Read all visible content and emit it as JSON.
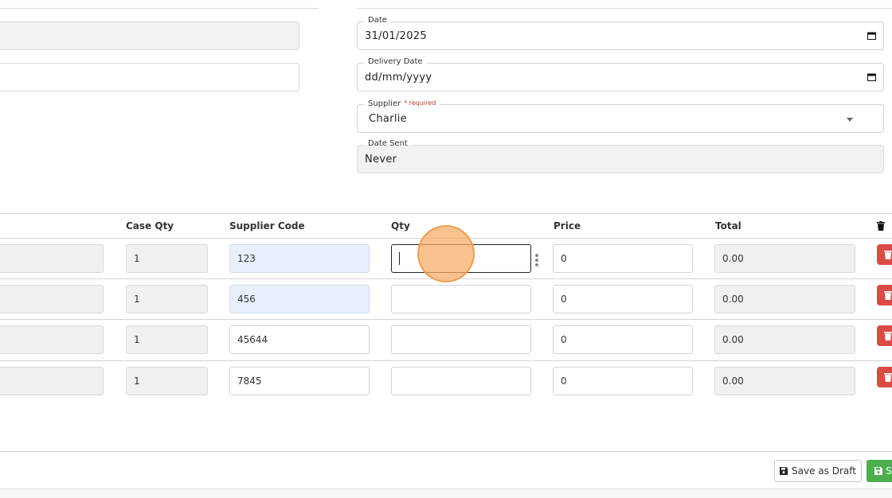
{
  "form": {
    "date": {
      "label": "Date",
      "value": "31/01/2025"
    },
    "delivery_date": {
      "label": "Delivery Date",
      "value": "dd/mm/yyyy"
    },
    "supplier": {
      "label": "Supplier",
      "required": "* required",
      "value": "Charlie"
    },
    "date_sent": {
      "label": "Date Sent",
      "value": "Never"
    }
  },
  "table": {
    "headers": {
      "case_qty": "Case Qty",
      "supplier_code": "Supplier Code",
      "qty": "Qty",
      "price": "Price",
      "total": "Total"
    },
    "rows": [
      {
        "case_qty": "1",
        "supplier_code": "123",
        "qty": "",
        "price": "0",
        "total": "0.00"
      },
      {
        "case_qty": "1",
        "supplier_code": "456",
        "qty": "",
        "price": "0",
        "total": "0.00"
      },
      {
        "case_qty": "1",
        "supplier_code": "45644",
        "qty": "",
        "price": "0",
        "total": "0.00"
      },
      {
        "case_qty": "1",
        "supplier_code": "7845",
        "qty": "",
        "price": "0",
        "total": "0.00"
      }
    ]
  },
  "footer": {
    "save_draft_label": "Save as Draft",
    "save_label": "S"
  },
  "colors": {
    "danger": "#dc4a46",
    "success": "#4cae4c",
    "highlight": "#e8f0fd",
    "cursor": "#f7aa64"
  },
  "icons": {
    "calendar": "calendar-icon",
    "trash": "trash-icon",
    "save": "floppy-disk-icon",
    "dropdown": "chevron-down-icon"
  }
}
